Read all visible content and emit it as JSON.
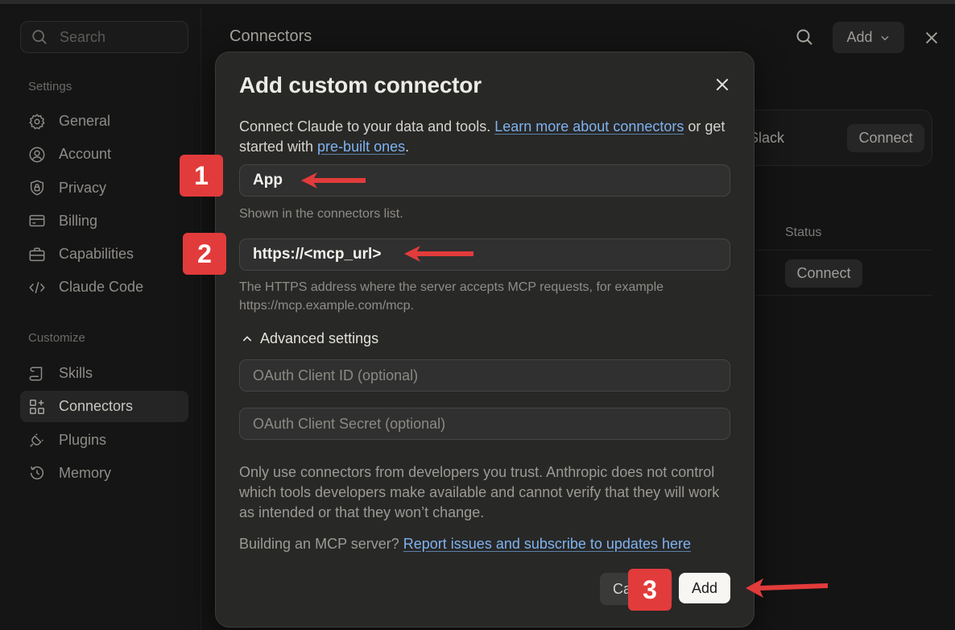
{
  "sidebar": {
    "search_placeholder": "Search",
    "settings_label": "Settings",
    "customize_label": "Customize",
    "settings_items": [
      {
        "label": "General",
        "icon": "gear-icon"
      },
      {
        "label": "Account",
        "icon": "account-icon"
      },
      {
        "label": "Privacy",
        "icon": "shield-icon"
      },
      {
        "label": "Billing",
        "icon": "credit-card-icon"
      },
      {
        "label": "Capabilities",
        "icon": "briefcase-icon"
      },
      {
        "label": "Claude Code",
        "icon": "code-icon"
      }
    ],
    "customize_items": [
      {
        "label": "Skills",
        "icon": "scroll-icon"
      },
      {
        "label": "Connectors",
        "icon": "grid-plus-icon",
        "active": true
      },
      {
        "label": "Plugins",
        "icon": "plug-icon"
      },
      {
        "label": "Memory",
        "icon": "history-icon"
      }
    ]
  },
  "main": {
    "title": "Connectors",
    "add_label": "Add",
    "card_name_partial": "Slack",
    "card_connect": "Connect",
    "status_header": "Status",
    "row_connect": "Connect"
  },
  "modal": {
    "title": "Add custom connector",
    "desc_prefix": "Connect Claude to your data and tools. ",
    "desc_link1": "Learn more about connectors",
    "desc_mid": " or get started with ",
    "desc_link2": "pre-built ones",
    "desc_suffix": ".",
    "name_value": "App",
    "name_help": "Shown in the connectors list.",
    "url_value": "https://<mcp_url>",
    "url_help": "The HTTPS address where the server accepts MCP requests, for example https://mcp.example.com/mcp.",
    "advanced_label": "Advanced settings",
    "client_id_placeholder": "OAuth Client ID (optional)",
    "client_secret_placeholder": "OAuth Client Secret (optional)",
    "warning": "Only use connectors from developers you trust. Anthropic does not control which tools developers make available and cannot verify that they will work as intended or that they won’t change.",
    "build_prefix": "Building an MCP server? ",
    "build_link": "Report issues and subscribe to updates here",
    "cancel_label": "Cancel",
    "add_label": "Add"
  },
  "annotations": {
    "badge1": "1",
    "badge2": "2",
    "badge3": "3",
    "color": "#e23b3b"
  }
}
